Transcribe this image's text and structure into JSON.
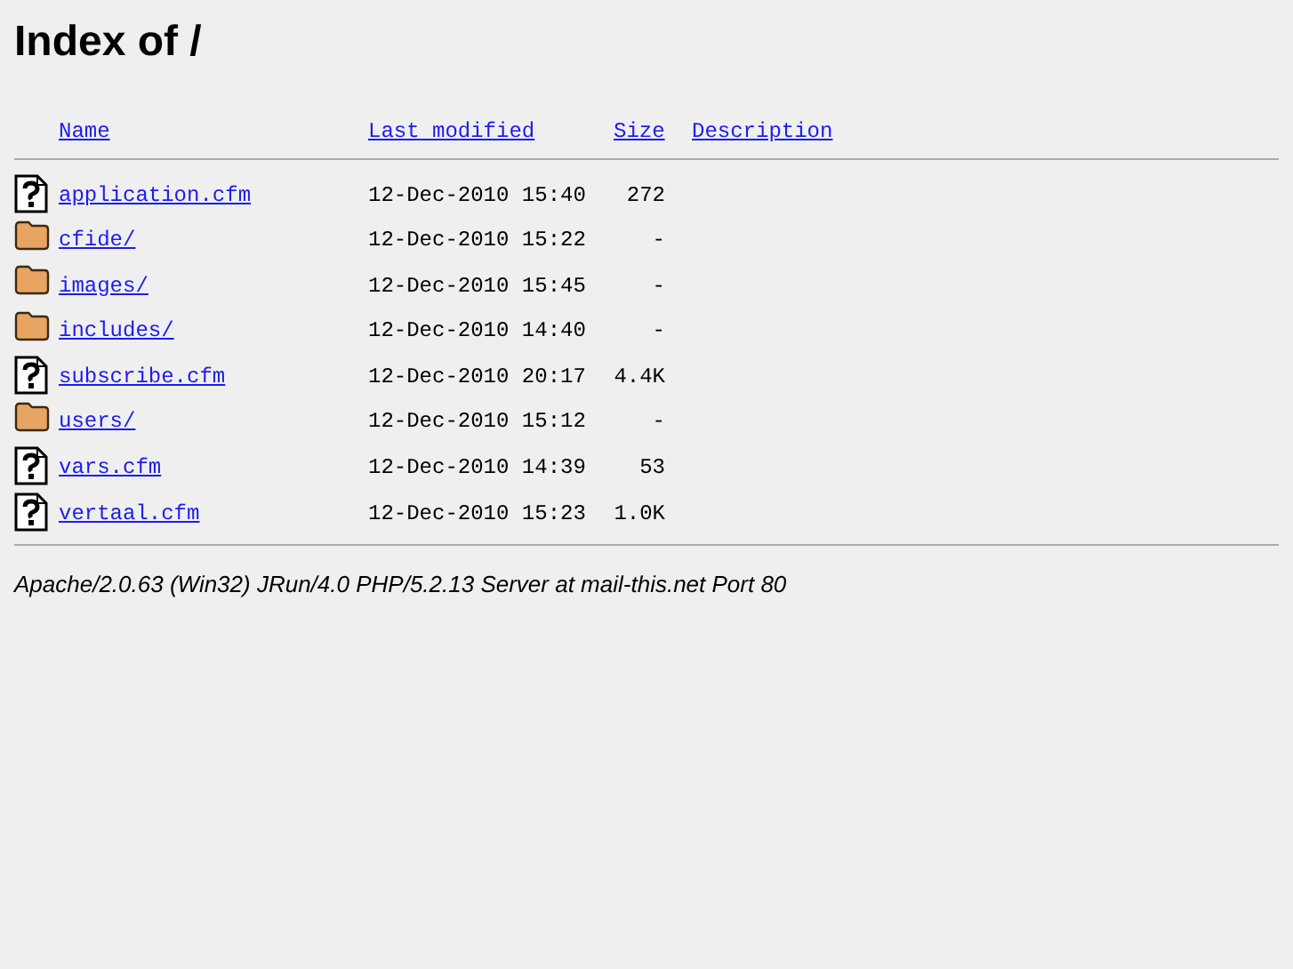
{
  "title": "Index of /",
  "columns": [
    "Name",
    "Last modified",
    "Size",
    "Description"
  ],
  "rows": [
    {
      "kind": "file",
      "name": "application.cfm",
      "modified": "12-Dec-2010 15:40",
      "size": "272"
    },
    {
      "kind": "folder",
      "name": "cfide/",
      "modified": "12-Dec-2010 15:22",
      "size": "-"
    },
    {
      "kind": "folder",
      "name": "images/",
      "modified": "12-Dec-2010 15:45",
      "size": "-"
    },
    {
      "kind": "folder",
      "name": "includes/",
      "modified": "12-Dec-2010 14:40",
      "size": "-"
    },
    {
      "kind": "file",
      "name": "subscribe.cfm",
      "modified": "12-Dec-2010 20:17",
      "size": "4.4K"
    },
    {
      "kind": "folder",
      "name": "users/",
      "modified": "12-Dec-2010 15:12",
      "size": "-"
    },
    {
      "kind": "file",
      "name": "vars.cfm",
      "modified": "12-Dec-2010 14:39",
      "size": "53"
    },
    {
      "kind": "file",
      "name": "vertaal.cfm",
      "modified": "12-Dec-2010 15:23",
      "size": "1.0K"
    }
  ],
  "footer": "Apache/2.0.63 (Win32) JRun/4.0 PHP/5.2.13 Server at mail-this.net Port 80"
}
